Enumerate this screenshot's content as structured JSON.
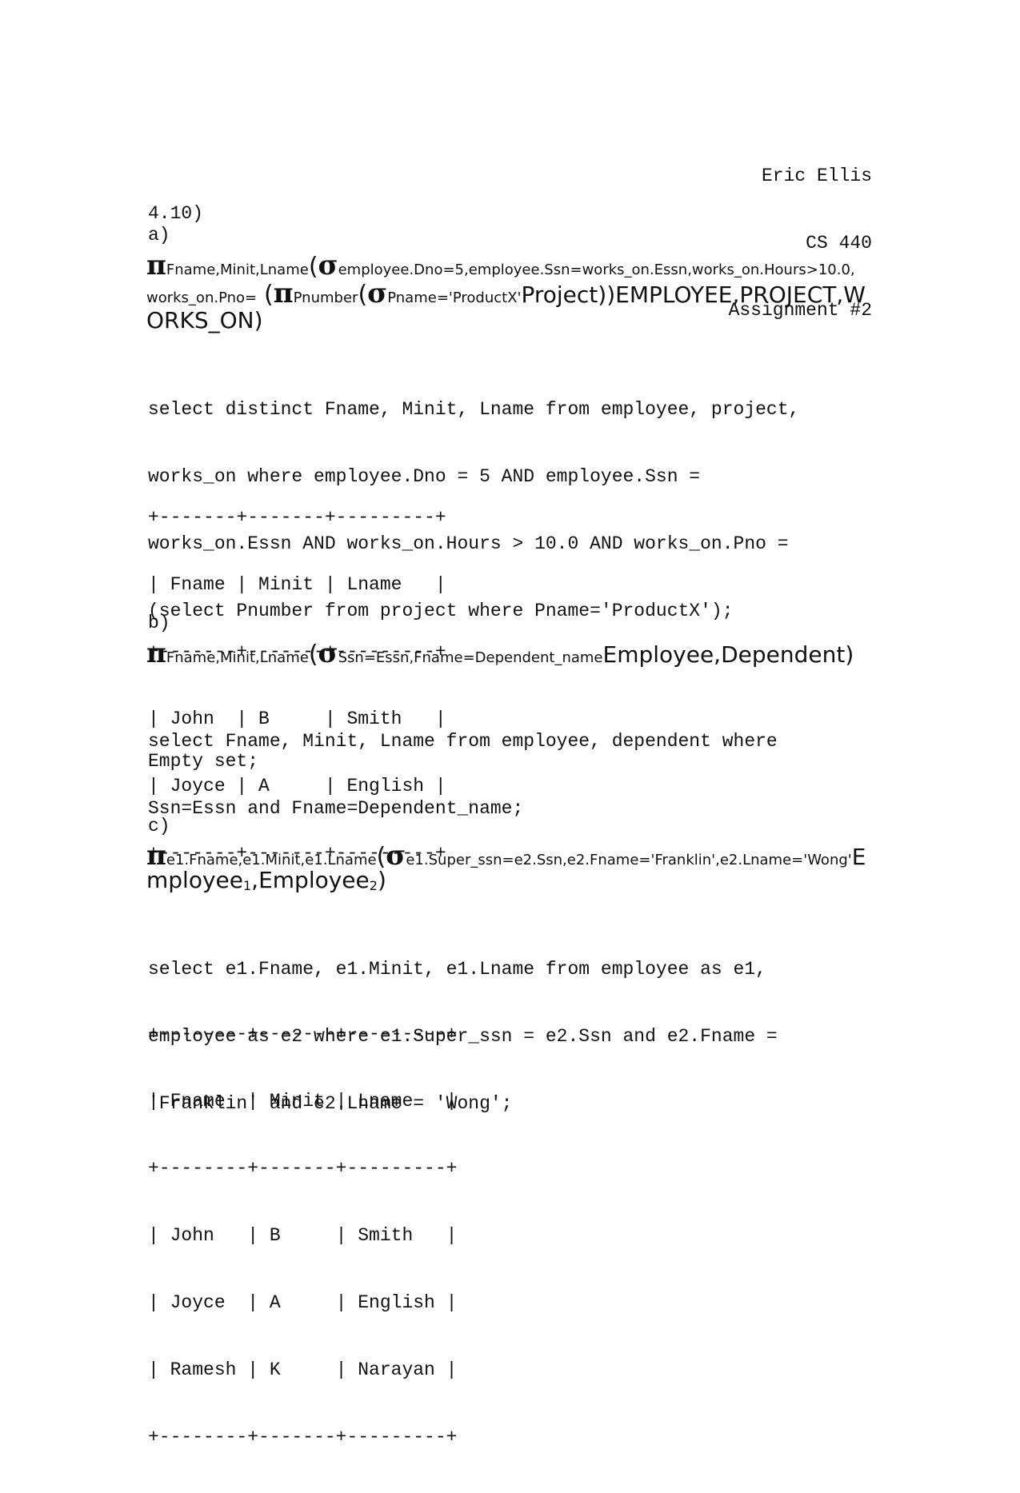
{
  "header": {
    "author": "Eric Ellis",
    "course": "CS 440",
    "assignment": "Assignment #2"
  },
  "problem": "4.10)",
  "a": {
    "label": "a)",
    "algebra": {
      "pi": "π",
      "sigma": "σ",
      "pi_sub": "Fname,Minit,Lname",
      "sigma_sub_line1": "employee.Dno=5,employee.Ssn=works_on.Essn,works_on.Hours>10.0,",
      "sigma_sub_line2": "works_on.Pno=",
      "inner_pi_sub": "Pnumber",
      "inner_sigma_sub": "Pname='ProductX'",
      "inner_rel": "Project))EMPLOYEE,PROJECT,W",
      "line3": "ORKS_ON)"
    },
    "sql": [
      "select distinct Fname, Minit, Lname from employee, project,",
      "works_on where employee.Dno = 5 AND employee.Ssn =",
      "works_on.Essn AND works_on.Hours > 10.0 AND works_on.Pno =",
      "(select Pnumber from project where Pname='ProductX');"
    ],
    "result": [
      "+-------+-------+---------+",
      "| Fname | Minit | Lname   |",
      "+-------+-------+---------+",
      "| John  | B     | Smith   |",
      "| Joyce | A     | English |",
      "+-------+-------+---------+"
    ]
  },
  "b": {
    "label": "b)",
    "algebra": {
      "pi": "π",
      "sigma": "σ",
      "pi_sub": "Fname,Minit,Lname",
      "sigma_sub": "Ssn=Essn,Fname=Dependent_name",
      "rel": "Employee,Dependent)"
    },
    "sql": [
      "select Fname, Minit, Lname from employee, dependent where",
      "Ssn=Essn and Fname=Dependent_name;"
    ],
    "result": "Empty set;"
  },
  "c": {
    "label": "c)",
    "algebra": {
      "pi": "π",
      "sigma": "σ",
      "pi_sub": "e1.Fname,e1.Minit,e1.Lname",
      "sigma_sub": "e1.Super_ssn=e2.Ssn,e2.Fname='Franklin',e2.Lname='Wong'",
      "rel_line1": "E",
      "rel_line2_a": "mployee",
      "rel_line2_sub1": "1",
      "rel_line2_b": ",Employee",
      "rel_line2_sub2": "2",
      "rel_line2_c": ")"
    },
    "sql": [
      "select e1.Fname, e1.Minit, e1.Lname from employee as e1,",
      "employee as e2 where e1.Super_ssn = e2.Ssn and e2.Fname =",
      "'Franklin' and e2.Lname = 'Wong';"
    ],
    "result": [
      "+--------+-------+---------+",
      "| Fname  | Minit | Lname   |",
      "+--------+-------+---------+",
      "| John   | B     | Smith   |",
      "| Joyce  | A     | English |",
      "| Ramesh | K     | Narayan |",
      "+--------+-------+---------+"
    ]
  }
}
